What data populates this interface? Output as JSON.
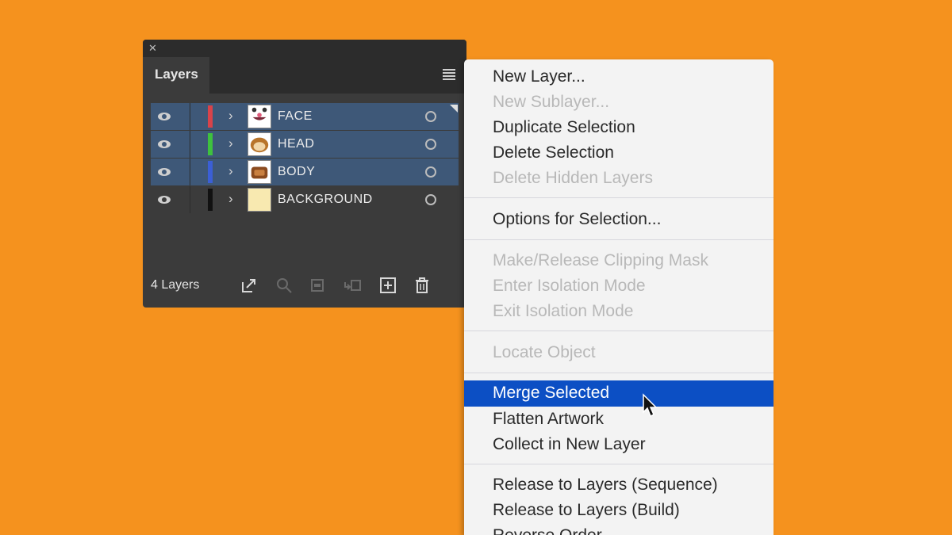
{
  "panel": {
    "tab_label": "Layers",
    "close_glyph": "✕",
    "layer_count": "4 Layers",
    "layers": [
      {
        "name": "FACE",
        "color": "#d9434a",
        "selected": true
      },
      {
        "name": "HEAD",
        "color": "#3ec13e",
        "selected": true
      },
      {
        "name": "BODY",
        "color": "#3b5fd6",
        "selected": true
      },
      {
        "name": "BACKGROUND",
        "color": "#111111",
        "selected": false
      }
    ],
    "footer_icons": [
      "export-icon",
      "locate-icon",
      "clipping-mask-icon",
      "sublayer-icon",
      "new-layer-icon",
      "trash-icon"
    ]
  },
  "menu": {
    "items": [
      {
        "label": "New Layer...",
        "enabled": true
      },
      {
        "label": "New Sublayer...",
        "enabled": false
      },
      {
        "label": "Duplicate Selection",
        "enabled": true
      },
      {
        "label": "Delete Selection",
        "enabled": true
      },
      {
        "label": "Delete Hidden Layers",
        "enabled": false
      },
      {
        "label": "Options for Selection...",
        "enabled": true
      },
      {
        "label": "Make/Release Clipping Mask",
        "enabled": false
      },
      {
        "label": "Enter Isolation Mode",
        "enabled": false
      },
      {
        "label": "Exit Isolation Mode",
        "enabled": false
      },
      {
        "label": "Locate Object",
        "enabled": false
      },
      {
        "label": "Merge Selected",
        "enabled": true,
        "highlighted": true
      },
      {
        "label": "Flatten Artwork",
        "enabled": true
      },
      {
        "label": "Collect in New Layer",
        "enabled": true
      },
      {
        "label": "Release to Layers (Sequence)",
        "enabled": true
      },
      {
        "label": "Release to Layers (Build)",
        "enabled": true
      },
      {
        "label": "Reverse Order",
        "enabled": true
      }
    ]
  },
  "colors": {
    "background": "#F5921E",
    "highlight": "#0c4fc4",
    "selection": "#3e5878"
  }
}
